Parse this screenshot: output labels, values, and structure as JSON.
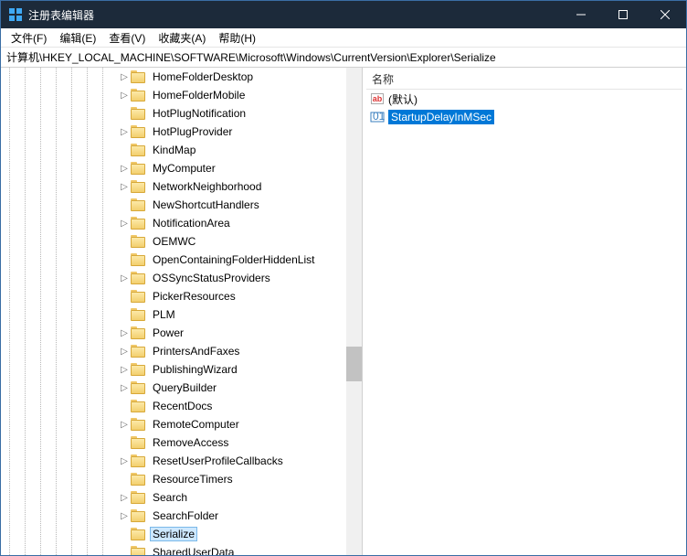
{
  "title": "注册表编辑器",
  "menus": {
    "file": "文件(F)",
    "edit": "编辑(E)",
    "view": "查看(V)",
    "fav": "收藏夹(A)",
    "help": "帮助(H)"
  },
  "address": "计算机\\HKEY_LOCAL_MACHINE\\SOFTWARE\\Microsoft\\Windows\\CurrentVersion\\Explorer\\Serialize",
  "tree": [
    {
      "exp": ">",
      "label": "HomeFolderDesktop"
    },
    {
      "exp": ">",
      "label": "HomeFolderMobile"
    },
    {
      "exp": "",
      "label": "HotPlugNotification"
    },
    {
      "exp": ">",
      "label": "HotPlugProvider"
    },
    {
      "exp": "",
      "label": "KindMap"
    },
    {
      "exp": ">",
      "label": "MyComputer"
    },
    {
      "exp": ">",
      "label": "NetworkNeighborhood"
    },
    {
      "exp": "",
      "label": "NewShortcutHandlers"
    },
    {
      "exp": ">",
      "label": "NotificationArea"
    },
    {
      "exp": "",
      "label": "OEMWC"
    },
    {
      "exp": "",
      "label": "OpenContainingFolderHiddenList"
    },
    {
      "exp": ">",
      "label": "OSSyncStatusProviders"
    },
    {
      "exp": "",
      "label": "PickerResources"
    },
    {
      "exp": "",
      "label": "PLM"
    },
    {
      "exp": ">",
      "label": "Power"
    },
    {
      "exp": ">",
      "label": "PrintersAndFaxes"
    },
    {
      "exp": ">",
      "label": "PublishingWizard"
    },
    {
      "exp": ">",
      "label": "QueryBuilder"
    },
    {
      "exp": "",
      "label": "RecentDocs"
    },
    {
      "exp": ">",
      "label": "RemoteComputer"
    },
    {
      "exp": "",
      "label": "RemoveAccess"
    },
    {
      "exp": ">",
      "label": "ResetUserProfileCallbacks"
    },
    {
      "exp": "",
      "label": "ResourceTimers"
    },
    {
      "exp": ">",
      "label": "Search"
    },
    {
      "exp": ">",
      "label": "SearchFolder"
    },
    {
      "exp": "",
      "label": "Serialize",
      "selected": true
    },
    {
      "exp": "",
      "label": "SharedUserData"
    }
  ],
  "list": {
    "header": "名称",
    "rows": [
      {
        "icon": "string",
        "label": "(默认)",
        "selected": false
      },
      {
        "icon": "dword",
        "label": "StartupDelayInMSec",
        "selected": true
      }
    ]
  }
}
